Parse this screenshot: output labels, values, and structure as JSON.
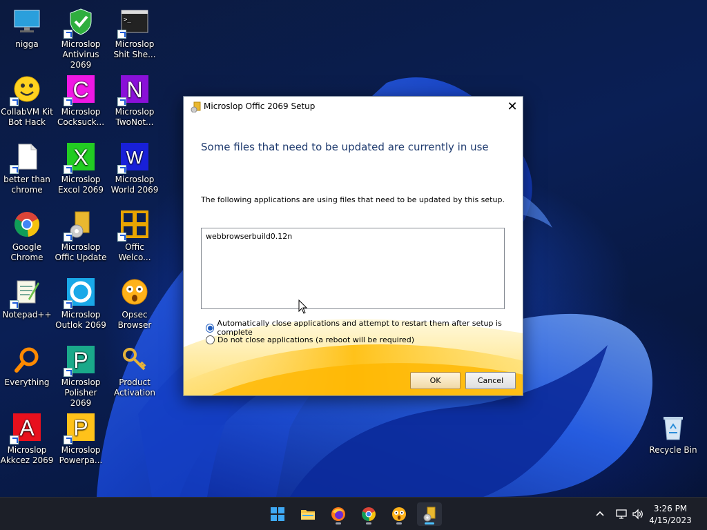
{
  "desktop": {
    "icons": [
      {
        "label": "nigga",
        "icon": "monitor-icon"
      },
      {
        "label": "Microslop Antivirus 2069",
        "icon": "shield-icon"
      },
      {
        "label": "Microslop Shit She...",
        "icon": "terminal-icon"
      },
      {
        "label": "CollabVM Kit Bot Hack",
        "icon": "smiley-icon"
      },
      {
        "label": "Microslop Cocksuck...",
        "icon": "letter-c-icon"
      },
      {
        "label": "Microslop TwoNot...",
        "icon": "letter-n-icon"
      },
      {
        "label": "better than chrome",
        "icon": "blank-document-icon"
      },
      {
        "label": "Microslop Excol 2069",
        "icon": "letter-x-icon"
      },
      {
        "label": "Microslop World 2069",
        "icon": "letter-w-icon"
      },
      {
        "label": "Google Chrome",
        "icon": "chrome-icon"
      },
      {
        "label": "Microslop Offic Update",
        "icon": "office-update-icon"
      },
      {
        "label": "Offic Welco...",
        "icon": "office-logo-icon"
      },
      {
        "label": "Notepad++",
        "icon": "notepadpp-icon"
      },
      {
        "label": "Microslop Outlok 2069",
        "icon": "letter-o-icon"
      },
      {
        "label": "Opsec Browser",
        "icon": "shocked-face-icon"
      },
      {
        "label": "Everything",
        "icon": "magnifier-icon"
      },
      {
        "label": "Microslop Polisher 2069",
        "icon": "letter-p-green-icon"
      },
      {
        "label": "Product Activation",
        "icon": "keys-icon"
      },
      {
        "label": "Microslop Akkcez 2069",
        "icon": "letter-a-icon"
      },
      {
        "label": "Microslop Powerpa...",
        "icon": "letter-p-yellow-icon"
      },
      {
        "label": "Recycle Bin",
        "icon": "recycle-bin-icon"
      }
    ]
  },
  "dialog": {
    "title": "Microslop Offic 2069 Setup",
    "heading": "Some files that need to be updated are currently in use",
    "description": "The following applications are using files that need to be updated by this setup.",
    "applications": [
      "webbrowserbuild0.12n"
    ],
    "options": [
      {
        "label": "Automatically close applications and attempt to restart them after setup is complete",
        "checked": true
      },
      {
        "label": "Do not close applications (a reboot will be required)",
        "checked": false
      }
    ],
    "ok_label": "OK",
    "cancel_label": "Cancel",
    "close_label": "✕"
  },
  "taskbar": {
    "apps": [
      {
        "name": "start",
        "icon": "windows-start-icon",
        "active": false
      },
      {
        "name": "file-explorer",
        "icon": "folder-icon",
        "active": false
      },
      {
        "name": "firefox",
        "icon": "firefox-icon",
        "active": false
      },
      {
        "name": "chrome",
        "icon": "chrome-icon",
        "active": false
      },
      {
        "name": "opsec-browser",
        "icon": "shocked-face-icon",
        "active": false
      },
      {
        "name": "office-setup",
        "icon": "office-update-icon",
        "active": true
      }
    ],
    "tray": {
      "time": "3:26 PM",
      "date": "4/15/2023"
    }
  },
  "colors": {
    "dialog_heading": "#1e3a6e",
    "radio_accent": "#1f5bbd",
    "taskbar_bg": "#1c1f28",
    "active_indicator": "#4cc2ff"
  }
}
